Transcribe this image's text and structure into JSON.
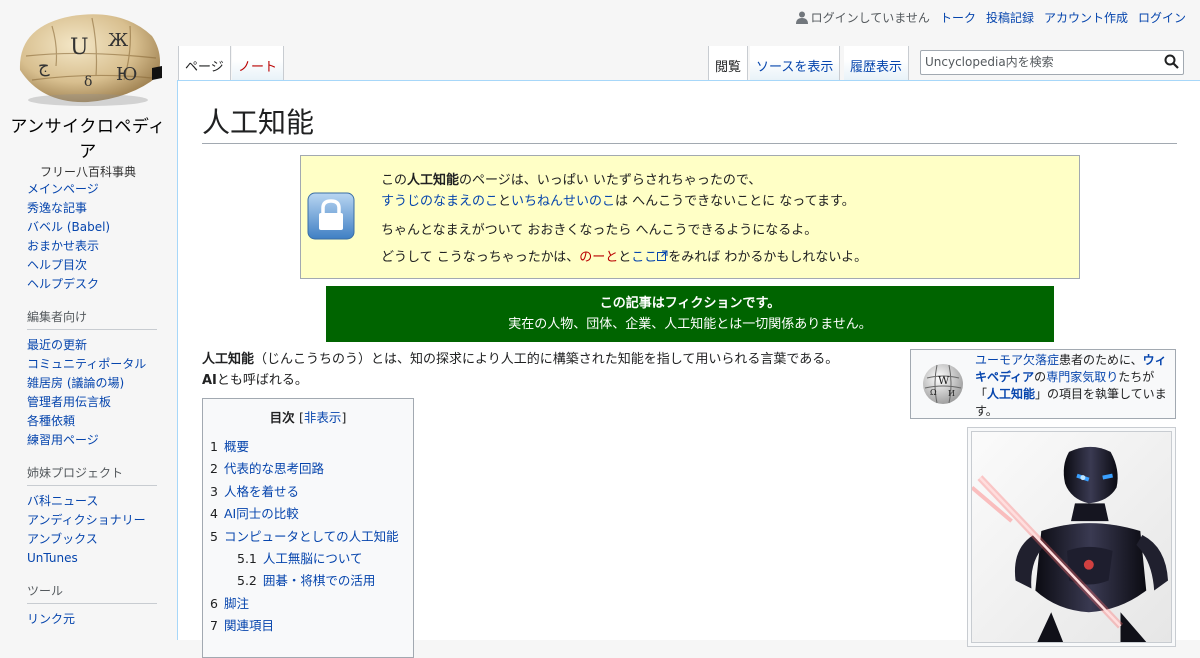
{
  "logo": {
    "wordmark": "アンサイクロペディア",
    "tagline": "フリー八百科事典"
  },
  "personal": {
    "not_logged_in": "ログインしていません",
    "talk": "トーク",
    "contributions": "投稿記録",
    "create_account": "アカウント作成",
    "login": "ログイン"
  },
  "tabs": {
    "page": "ページ",
    "talk": "ノート",
    "read": "閲覧",
    "view_source": "ソースを表示",
    "history": "履歴表示"
  },
  "search": {
    "placeholder": "Uncyclopedia内を検索"
  },
  "sidebar": {
    "main": [
      "メインページ",
      "秀逸な記事",
      "バベル (Babel)",
      "おまかせ表示",
      "ヘルプ目次",
      "ヘルプデスク"
    ],
    "editors": {
      "heading": "編集者向け",
      "items": [
        "最近の更新",
        "コミュニティポータル",
        "雑居房 (議論の場)",
        "管理者用伝言板",
        "各種依頼",
        "練習用ページ"
      ]
    },
    "sister": {
      "heading": "姉妹プロジェクト",
      "items": [
        "バ科ニュース",
        "アンディクショナリー",
        "アンブックス",
        "UnTunes"
      ]
    },
    "tools": {
      "heading": "ツール",
      "items": [
        "リンク元"
      ]
    }
  },
  "article": {
    "title": "人工知能",
    "protect": {
      "l1_a": "この",
      "l1_b": "人工知能",
      "l1_c": "のページは、いっぱい いたずらされちゃったので、",
      "l2_a": "すうじのなまえのこ",
      "l2_b": "と",
      "l2_c": "いちねんせいのこ",
      "l2_d": "は へんこうできないことに なってます。",
      "l3": "ちゃんとなまえがついて おおきくなったら へんこうできるようになるよ。",
      "l4_a": "どうして こうなっちゃったかは、",
      "l4_b": "のーと",
      "l4_c": "と",
      "l4_d": "ここ",
      "l4_e": "をみれば わかるかもしれないよ。"
    },
    "fiction": {
      "title": "この記事はフィクションです。",
      "text": "実在の人物、団体、企業、人工知能とは一切関係ありません。"
    },
    "intro": {
      "term": "人工知能",
      "reading": "（じんこうちのう）とは、知の探求により人工的に構築された知能を指して用いられる言葉である。",
      "alt": "AI",
      "alt_rest": "とも呼ばれる。"
    },
    "toc": {
      "title": "目次",
      "hide": "非表示",
      "items": [
        {
          "num": "1",
          "label": "概要"
        },
        {
          "num": "2",
          "label": "代表的な思考回路"
        },
        {
          "num": "3",
          "label": "人格を着せる"
        },
        {
          "num": "4",
          "label": "AI同士の比較"
        },
        {
          "num": "5",
          "label": "コンピュータとしての人工知能"
        },
        {
          "num": "5.1",
          "label": "人工無脳について"
        },
        {
          "num": "5.2",
          "label": "囲碁・将棋での活用"
        },
        {
          "num": "6",
          "label": "脚注"
        },
        {
          "num": "7",
          "label": "関連項目"
        }
      ]
    },
    "wikipedia_box": {
      "a": "ユーモア欠落症",
      "b": "患者のために、",
      "c": "ウィキペディア",
      "d": "の",
      "e": "専門家気取り",
      "f": "たちが「",
      "g": "人工知能",
      "h": "」の項目を執筆しています。"
    }
  },
  "colors": {
    "link": "#0645ad",
    "redlink": "#ba0000",
    "fiction_bg": "#006400",
    "protect_bg": "#ffffc6"
  },
  "icons": [
    "puzzle-globe-logo",
    "user-icon",
    "search-icon",
    "lock-icon",
    "external-link-icon",
    "wikipedia-globe-icon"
  ]
}
